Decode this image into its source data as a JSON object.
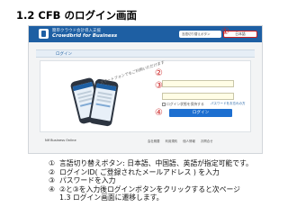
{
  "slide": {
    "title": "1.2 CFB のログイン画面"
  },
  "screen": {
    "brand_line1": "簡単クラウド会計導入支援",
    "brand_line2": "Crowdbrid for Business",
    "lang_select": "言語切り替えボタン",
    "lang_button": "日本語",
    "login_tab": "ログイン",
    "smart_caption": "スマートフォンでもご利用いただけます",
    "keep_login": "ログイン状態を保持する",
    "forgot_password": "パスワードをお忘れの方",
    "login_button": "ログイン",
    "footer_logo": "Nif Business Online",
    "footer_links": [
      "会社概要",
      "利用規約",
      "個人情報",
      "お問合せ"
    ],
    "markers": {
      "m1": "①",
      "m2": "②",
      "m3": "③",
      "m4": "④"
    }
  },
  "notes": [
    {
      "num": "①",
      "text": "言語切り替えボタン: 日本語、中国語、英語が指定可能です。"
    },
    {
      "num": "②",
      "text": "ログインID( ご登録されたメールアドレス ) を入力"
    },
    {
      "num": "③",
      "text": "パスワードを入力"
    },
    {
      "num": "④",
      "text": "②と③を入力後ログインボタンをクリックすると次ページ"
    }
  ],
  "note_continuation": "1.3 ログイン画面に遷移します。"
}
